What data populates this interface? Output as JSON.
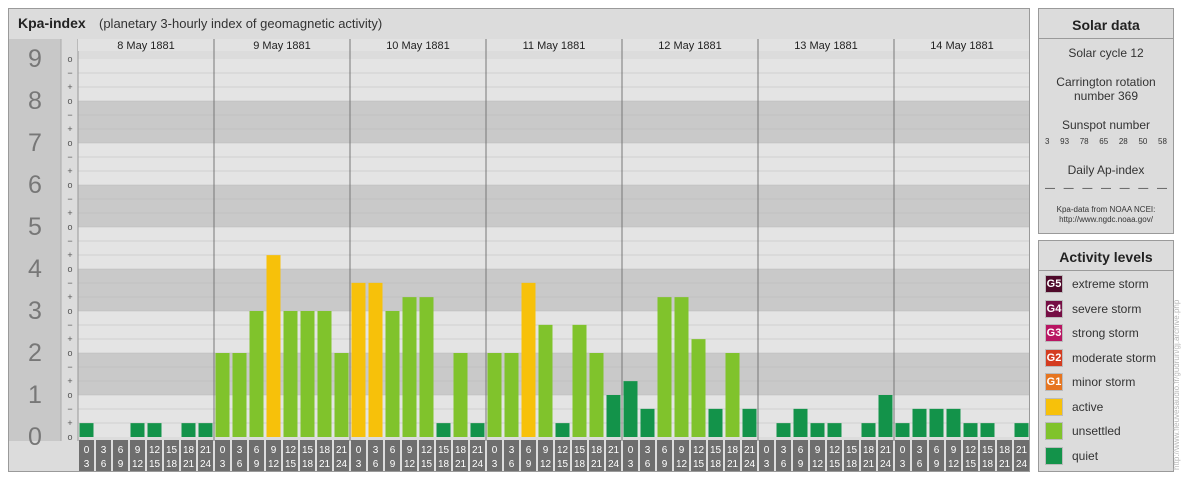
{
  "header": {
    "title": "Kpa-index",
    "subtitle": "(planetary 3-hourly index of geomagnetic activity)"
  },
  "chart_data": {
    "type": "bar",
    "ylim": [
      0,
      9
    ],
    "y_major_ticks": [
      "0",
      "1",
      "2",
      "3",
      "4",
      "5",
      "6",
      "7",
      "8",
      "9"
    ],
    "y_minor_marks": [
      "+",
      "o",
      "−"
    ],
    "days": [
      "8 May 1881",
      "9 May 1881",
      "10 May 1881",
      "11 May 1881",
      "12 May 1881",
      "13 May 1881",
      "14 May 1881"
    ],
    "interval_start": [
      "0",
      "3",
      "6",
      "9",
      "12",
      "15",
      "18",
      "21"
    ],
    "interval_end": [
      "3",
      "6",
      "9",
      "12",
      "15",
      "18",
      "21",
      "24"
    ],
    "values": [
      0.33,
      0,
      0,
      0.33,
      0.33,
      0,
      0.33,
      0.33,
      2,
      2,
      3,
      4.33,
      3,
      3,
      3,
      2,
      3.67,
      3.67,
      3,
      3.33,
      3.33,
      0.33,
      2,
      0.33,
      2,
      2,
      3.67,
      2.67,
      0.33,
      2.67,
      2,
      1,
      1.33,
      0.67,
      3.33,
      3.33,
      2.33,
      0.67,
      2,
      0.67,
      0,
      0.33,
      0.67,
      0.33,
      0.33,
      0,
      0.33,
      1,
      0.33,
      0.67,
      0.67,
      0.67,
      0.33,
      0.33,
      0,
      0.33
    ],
    "colors": {
      "quiet": "#13934a",
      "unsettled": "#80c32c",
      "active": "#f7c10a"
    }
  },
  "solar": {
    "title": "Solar data",
    "cycle": "Solar cycle 12",
    "carrington_1": "Carrington rotation",
    "carrington_2": "number 369",
    "sunspot_title": "Sunspot number",
    "sunspot_values": [
      "3",
      "93",
      "78",
      "65",
      "28",
      "50",
      "58"
    ],
    "ap_title": "Daily Ap-index",
    "ap_values": [
      "—",
      "—",
      "—",
      "—",
      "—",
      "—",
      "—"
    ],
    "source_1": "Kpa-data from NOAA NCEI:",
    "source_2": "http://www.ngdc.noaa.gov/"
  },
  "activity": {
    "title": "Activity levels",
    "levels": [
      {
        "code": "G5",
        "label": "extreme storm",
        "color": "#4f0a2a"
      },
      {
        "code": "G4",
        "label": "severe storm",
        "color": "#750e44"
      },
      {
        "code": "G3",
        "label": "strong storm",
        "color": "#b81562"
      },
      {
        "code": "G2",
        "label": "moderate storm",
        "color": "#d43c20"
      },
      {
        "code": "G1",
        "label": "minor storm",
        "color": "#e67520"
      },
      {
        "code": "",
        "label": "active",
        "color": "#f7c10a"
      },
      {
        "code": "",
        "label": "unsettled",
        "color": "#80c32c"
      },
      {
        "code": "",
        "label": "quiet",
        "color": "#13934a"
      }
    ]
  },
  "watermark": "http://www.fleuvesaudio.fr/gudrun/gj.archive.php"
}
